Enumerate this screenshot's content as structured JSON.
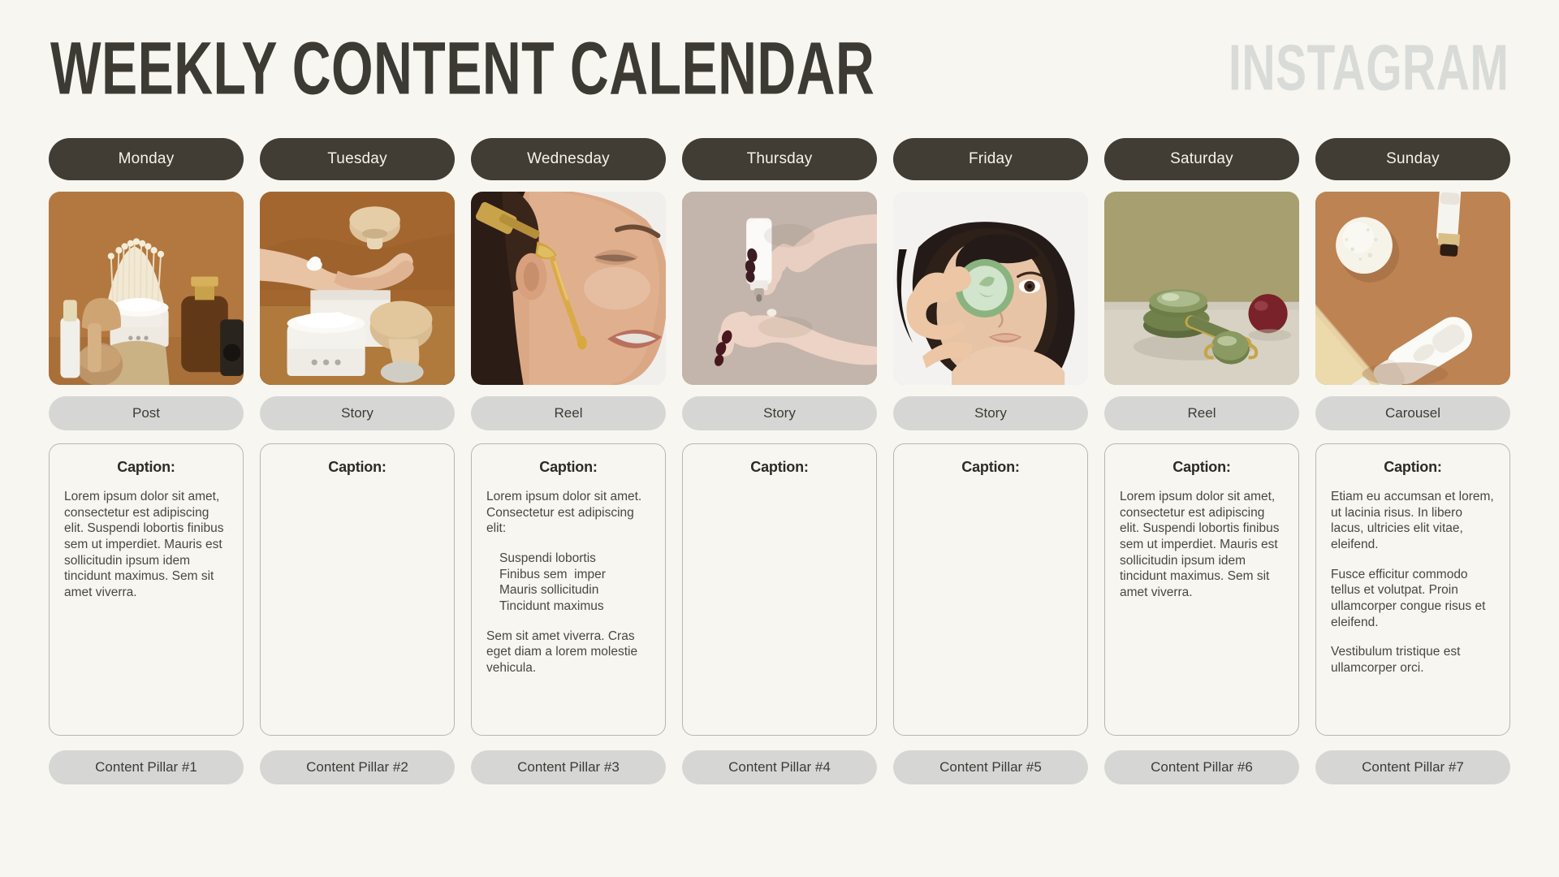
{
  "header": {
    "title": "WEEKLY CONTENT CALENDAR",
    "platform": "INSTAGRAM"
  },
  "labels": {
    "caption_heading": "Caption:"
  },
  "colors": {
    "background": "#f7f6f0",
    "ink": "#3d3a34",
    "day_pill_bg": "#413c34",
    "day_pill_text": "#f5f3ed",
    "tag_pill_bg": "#d6d7d5",
    "platform_text": "#d9dbd9",
    "card_border": "#b9b6ae"
  },
  "days": [
    {
      "day": "Monday",
      "content_type": "Post",
      "pillar": "Content Pillar #1",
      "image_name": "mushroom-skincare-still-life",
      "caption": {
        "blocks": [
          {
            "type": "p",
            "text": "Lorem ipsum dolor sit amet, consectetur est adipiscing elit. Suspendi lobortis finibus sem ut imperdiet. Mauris est sollicitudin ipsum idem tincidunt maximus. Sem sit amet viverra."
          }
        ]
      }
    },
    {
      "day": "Tuesday",
      "content_type": "Story",
      "pillar": "Content Pillar #2",
      "image_name": "hand-cream-mushrooms",
      "caption": {
        "blocks": []
      }
    },
    {
      "day": "Wednesday",
      "content_type": "Reel",
      "pillar": "Content Pillar #3",
      "image_name": "face-serum-dropper",
      "caption": {
        "blocks": [
          {
            "type": "p",
            "text": "Lorem ipsum dolor sit amet. Consectetur est adipiscing elit:"
          },
          {
            "type": "ul",
            "items": [
              "Suspendi lobortis",
              "Finibus sem  imper",
              "Mauris sollicitudin",
              "Tincidunt maximus"
            ]
          },
          {
            "type": "p",
            "text": "Sem sit amet viverra. Cras eget diam a lorem molestie vehicula."
          }
        ]
      }
    },
    {
      "day": "Thursday",
      "content_type": "Story",
      "pillar": "Content Pillar #4",
      "image_name": "hands-cream-tube",
      "caption": {
        "blocks": []
      }
    },
    {
      "day": "Friday",
      "content_type": "Story",
      "pillar": "Content Pillar #5",
      "image_name": "model-holding-green-jar",
      "caption": {
        "blocks": []
      }
    },
    {
      "day": "Saturday",
      "content_type": "Reel",
      "pillar": "Content Pillar #6",
      "image_name": "jade-roller-still-life",
      "caption": {
        "blocks": [
          {
            "type": "p",
            "text": "Lorem ipsum dolor sit amet, consectetur est adipiscing elit. Suspendi lobortis finibus sem ut imperdiet. Mauris est sollicitudin ipsum idem tincidunt maximus. Sem sit amet viverra."
          }
        ]
      }
    },
    {
      "day": "Sunday",
      "content_type": "Carousel",
      "pillar": "Content Pillar #7",
      "image_name": "bath-bomb-flatlay",
      "caption": {
        "blocks": [
          {
            "type": "p",
            "text": "Etiam eu accumsan et lorem, ut lacinia risus. In libero lacus, ultricies elit vitae, eleifend."
          },
          {
            "type": "p",
            "text": "Fusce efficitur commodo tellus et volutpat. Proin ullamcorper congue risus et eleifend."
          },
          {
            "type": "p",
            "text": "Vestibulum tristique est ullamcorper orci."
          }
        ]
      }
    }
  ]
}
